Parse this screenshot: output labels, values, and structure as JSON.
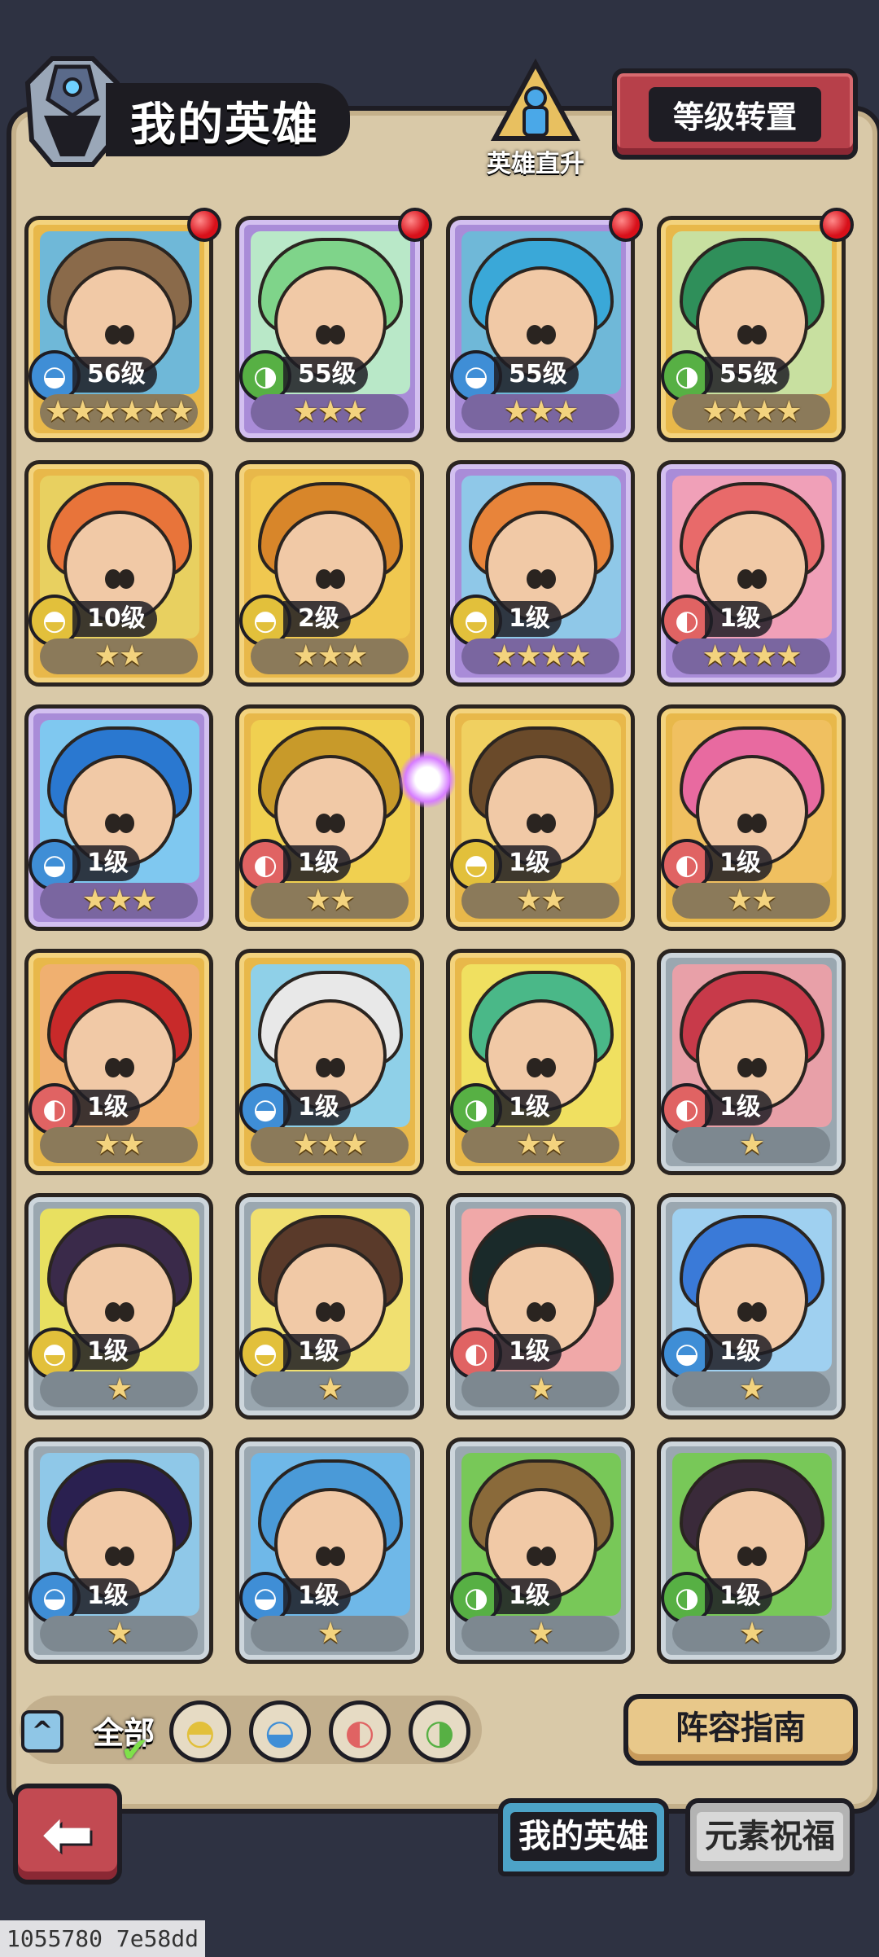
{
  "header": {
    "title": "我的英雄",
    "promote_label": "英雄直升",
    "reset_button": "等级转置"
  },
  "heroes": [
    {
      "level": "56级",
      "element": "water",
      "stars": "★★★★★★",
      "frame": "gold",
      "badge": true,
      "hair": "#8a6a4a",
      "bg": "#6fb8d8"
    },
    {
      "level": "55级",
      "element": "wind",
      "stars": "★★★",
      "frame": "purple",
      "badge": true,
      "hair": "#7fd48a",
      "bg": "#b9e8c8"
    },
    {
      "level": "55级",
      "element": "water",
      "stars": "★★★",
      "frame": "purple",
      "badge": true,
      "hair": "#3aa8d8",
      "bg": "#6fb8d8"
    },
    {
      "level": "55级",
      "element": "wind",
      "stars": "★★★★",
      "frame": "gold",
      "badge": true,
      "hair": "#2f8f5a",
      "bg": "#c8e0a0"
    },
    {
      "level": "10级",
      "element": "earth",
      "stars": "★★",
      "frame": "gold",
      "badge": false,
      "hair": "#e8743a",
      "bg": "#e8d060"
    },
    {
      "level": "2级",
      "element": "earth",
      "stars": "★★★",
      "frame": "gold",
      "badge": false,
      "hair": "#d8862a",
      "bg": "#f0c850"
    },
    {
      "level": "1级",
      "element": "earth",
      "stars": "★★★★",
      "frame": "purple",
      "badge": false,
      "hair": "#e8843a",
      "bg": "#8fc8e8"
    },
    {
      "level": "1级",
      "element": "fire",
      "stars": "★★★★",
      "frame": "purple",
      "badge": false,
      "hair": "#e86a6a",
      "bg": "#f0a0b8"
    },
    {
      "level": "1级",
      "element": "water",
      "stars": "★★★",
      "frame": "purple",
      "badge": false,
      "hair": "#2a78d0",
      "bg": "#7fc8f0"
    },
    {
      "level": "1级",
      "element": "fire",
      "stars": "★★",
      "frame": "gold",
      "badge": false,
      "hair": "#c89a2a",
      "bg": "#f0d050"
    },
    {
      "level": "1级",
      "element": "earth",
      "stars": "★★",
      "frame": "gold",
      "badge": false,
      "hair": "#6a4a2a",
      "bg": "#f0d060"
    },
    {
      "level": "1级",
      "element": "fire",
      "stars": "★★",
      "frame": "gold",
      "badge": false,
      "hair": "#e86aa0",
      "bg": "#f0c060"
    },
    {
      "level": "1级",
      "element": "fire",
      "stars": "★★",
      "frame": "gold",
      "badge": false,
      "hair": "#c82a2a",
      "bg": "#f0b070"
    },
    {
      "level": "1级",
      "element": "water",
      "stars": "★★★",
      "frame": "gold",
      "badge": false,
      "hair": "#e8e8e8",
      "bg": "#8fd0e8"
    },
    {
      "level": "1级",
      "element": "wind",
      "stars": "★★",
      "frame": "gold",
      "badge": false,
      "hair": "#4ab888",
      "bg": "#f0e060"
    },
    {
      "level": "1级",
      "element": "fire",
      "stars": "★",
      "frame": "silver",
      "badge": false,
      "hair": "#c83a4a",
      "bg": "#e8a0a8"
    },
    {
      "level": "1级",
      "element": "earth",
      "stars": "★",
      "frame": "silver",
      "badge": false,
      "hair": "#3a2a4a",
      "bg": "#e8e060"
    },
    {
      "level": "1级",
      "element": "earth",
      "stars": "★",
      "frame": "silver",
      "badge": false,
      "hair": "#5a3a2a",
      "bg": "#f0e070"
    },
    {
      "level": "1级",
      "element": "fire",
      "stars": "★",
      "frame": "silver",
      "badge": false,
      "hair": "#1a2a2a",
      "bg": "#f0a8a8"
    },
    {
      "level": "1级",
      "element": "water",
      "stars": "★",
      "frame": "silver",
      "badge": false,
      "hair": "#3a7ad8",
      "bg": "#9fd0f0"
    },
    {
      "level": "1级",
      "element": "water",
      "stars": "★",
      "frame": "silver",
      "badge": false,
      "hair": "#2a2050",
      "bg": "#8fc8e8"
    },
    {
      "level": "1级",
      "element": "water",
      "stars": "★",
      "frame": "silver",
      "badge": false,
      "hair": "#4a9ad8",
      "bg": "#6fb8e8"
    },
    {
      "level": "1级",
      "element": "wind",
      "stars": "★",
      "frame": "silver",
      "badge": false,
      "hair": "#8a6a3a",
      "bg": "#78c858"
    },
    {
      "level": "1级",
      "element": "wind",
      "stars": "★",
      "frame": "silver",
      "badge": false,
      "hair": "#3a2a3a",
      "bg": "#78c858"
    }
  ],
  "filter": {
    "collapse_icon": "^",
    "all_label": "全部",
    "check_icon": "✔",
    "elements": [
      {
        "name": "earth",
        "glyph": "◓",
        "color": "#e2c03b"
      },
      {
        "name": "water",
        "glyph": "◒",
        "color": "#3f8ed6"
      },
      {
        "name": "fire",
        "glyph": "◐",
        "color": "#e06363"
      },
      {
        "name": "wind",
        "glyph": "◑",
        "color": "#57b044"
      }
    ]
  },
  "guide_button": "阵容指南",
  "back_icon": "⬅",
  "tabs": {
    "my_heroes": "我的英雄",
    "element_blessing": "元素祝福"
  },
  "footer_id": "1055780 7e58dd",
  "colors": {
    "panel": "#d9c9a8",
    "water": "#3f8ed6",
    "wind": "#57b044",
    "earth": "#e2c03b",
    "fire": "#e06363"
  },
  "elem_glyphs": {
    "water": "◒",
    "wind": "◑",
    "earth": "◓",
    "fire": "◐"
  }
}
